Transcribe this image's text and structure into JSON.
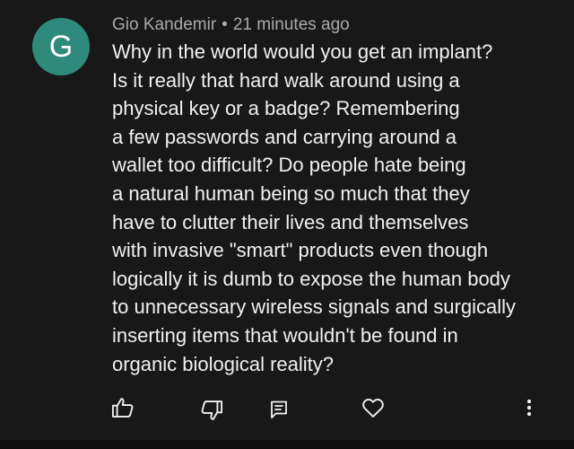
{
  "comment": {
    "avatar_letter": "G",
    "avatar_color": "#2f8a7b",
    "author": "Gio Kandemir",
    "separator": "•",
    "timestamp": "21 minutes ago",
    "body_lines": [
      "Why in the world would you get an implant?",
      "Is it really that hard walk around using a",
      "physical key or a badge? Remembering",
      "a few passwords and carrying around a",
      "wallet too difficult? Do people hate being",
      "a natural human being so much that they",
      "have to clutter their lives and themselves",
      "with invasive \"smart\" products even though",
      "logically it is dumb to expose the human body",
      "to unnecessary wireless signals and surgically",
      "inserting items that wouldn't be found in",
      "organic biological reality?"
    ]
  },
  "actions": {
    "icons": [
      "thumbs-up-icon",
      "thumbs-down-icon",
      "reply-icon",
      "heart-icon",
      "more-vertical-icon"
    ]
  },
  "colors": {
    "background": "#181818",
    "text": "#f1f1f1",
    "meta": "#aaaaaa"
  }
}
